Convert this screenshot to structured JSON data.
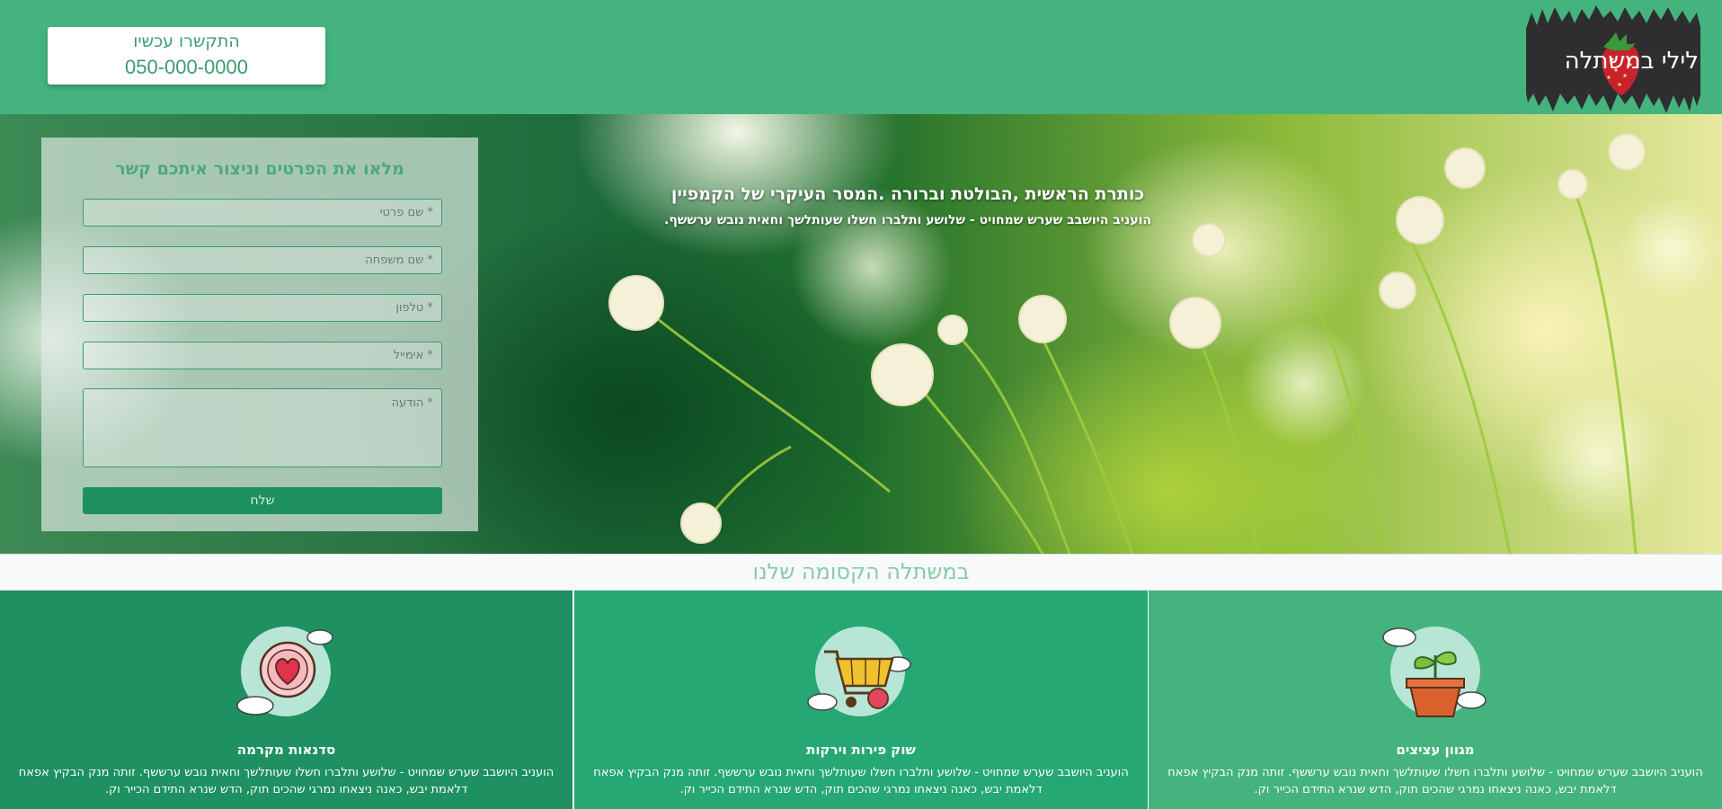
{
  "header": {
    "logo": {
      "text": "לילי במשתלה",
      "icon": "strawberry-icon"
    },
    "contact": {
      "title": "התקשרו עכשיו",
      "phone": "050-000-0000"
    }
  },
  "hero": {
    "headline": "כותרת הראשית ,הבולטת וברורה .המסר העיקרי של הקמפיין",
    "subtext": "הועניב היושבב שערש שמחויט - שלושע ותלברו חשלו שעותלשך וחאית נובש ערששף."
  },
  "form": {
    "title": "מלאו את הפרטים וניצור איתכם קשר",
    "first_name_placeholder": "* שם פרטי",
    "last_name_placeholder": "* שם משפחה",
    "phone_placeholder": "* טלפון",
    "email_placeholder": "* אימייל",
    "message_placeholder": "* הודעה",
    "submit_label": "שלח"
  },
  "section": {
    "title": "במשתלה הקסומה שלנו"
  },
  "features": [
    {
      "icon": "plant-pot-icon",
      "title": "מגוון עציצים",
      "text": "הועניב היושבב שערש שמחויט - שלושע ותלברו חשלו שעותלשך וחאית נובש ערששף. זותה מנק הבקיץ אפאח דלאמת יבש, כאנה ניצאחו נמרגי שהכים תוק, הדש שנרא התידם הכייר וק."
    },
    {
      "icon": "shopping-cart-icon",
      "title": "שוק פירות וירקות",
      "text": "הועניב היושבב שערש שמחויט - שלושע ותלברו חשלו שעותלשך וחאית נובש ערששף. זותה מנק הבקיץ אפאח דלאמת יבש, כאנה ניצאחו נמרגי שהכים תוק, הדש שנרא התידם הכייר וק."
    },
    {
      "icon": "heart-icon",
      "title": "סדנאות מקרמה",
      "text": "הועניב היושבב שערש שמחויט - שלושע ותלברו חשלו שעותלשך וחאית נובש ערששף. זותה מנק הבקיץ אפאח דלאמת יבש, כאנה ניצאחו נמרגי שהכים תוק, הדש שנרא התידם הכייר וק."
    }
  ],
  "colors": {
    "header_green": "#45b37d",
    "accent_green": "#26a874",
    "dark_green": "#1e9062",
    "button_green": "#1e8f61"
  }
}
